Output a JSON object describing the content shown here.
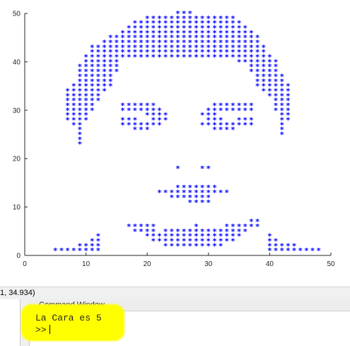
{
  "figure": {
    "coordinate_readout": "1, 34.934)",
    "marker_symbol": "*",
    "marker_color": "#0000ff",
    "axis_color": "#262626"
  },
  "chart_data": {
    "type": "scatter",
    "title": "",
    "xlabel": "",
    "ylabel": "",
    "xlim": [
      0,
      50
    ],
    "ylim": [
      0,
      50
    ],
    "xticks": [
      0,
      10,
      20,
      30,
      40,
      50
    ],
    "yticks": [
      0,
      10,
      20,
      30,
      40,
      50
    ],
    "grid": false,
    "series": [
      {
        "marker": "*",
        "color": "#0000ff",
        "hair": {
          "rows": [
            {
              "y": 50,
              "x0": 25,
              "x1": 27
            },
            {
              "y": 49,
              "x0": 20,
              "x1": 34
            },
            {
              "y": 48,
              "x0": 18,
              "x1": 35
            },
            {
              "y": 47,
              "x0": 17,
              "x1": 36
            },
            {
              "y": 46,
              "x0": 16,
              "x1": 37
            },
            {
              "y": 45,
              "x0": 14,
              "x1": 38
            },
            {
              "y": 44,
              "x0": 13,
              "x1": 38
            },
            {
              "y": 43,
              "x0": 11,
              "x1": 39
            },
            {
              "y": 42,
              "x0": 11,
              "x1": 39
            },
            {
              "y": 41,
              "x0": 10,
              "x1": 40
            }
          ],
          "left_side": [
            {
              "y": 40,
              "x0": 10,
              "x1": 15
            },
            {
              "y": 39,
              "x0": 9,
              "x1": 15
            },
            {
              "y": 38,
              "x0": 9,
              "x1": 15
            },
            {
              "y": 37,
              "x0": 9,
              "x1": 14
            },
            {
              "y": 36,
              "x0": 9,
              "x1": 14
            },
            {
              "y": 35,
              "x0": 8,
              "x1": 14
            },
            {
              "y": 34,
              "x0": 7,
              "x1": 13
            },
            {
              "y": 33,
              "x0": 7,
              "x1": 12
            },
            {
              "y": 32,
              "x0": 7,
              "x1": 12
            },
            {
              "y": 31,
              "x0": 7,
              "x1": 11
            },
            {
              "y": 30,
              "x0": 7,
              "x1": 11
            },
            {
              "y": 29,
              "x0": 7,
              "x1": 10
            },
            {
              "y": 28,
              "x0": 7,
              "x1": 10
            },
            {
              "y": 27,
              "x0": 8,
              "x1": 9
            },
            {
              "y": 26,
              "x0": 9,
              "x1": 9
            },
            {
              "y": 25,
              "x0": 9,
              "x1": 9
            },
            {
              "y": 24,
              "x0": 9,
              "x1": 9
            },
            {
              "y": 23,
              "x0": 9,
              "x1": 9
            }
          ],
          "right_side": [
            {
              "y": 40,
              "x0": 35,
              "x1": 41
            },
            {
              "y": 39,
              "x0": 37,
              "x1": 41
            },
            {
              "y": 38,
              "x0": 37,
              "x1": 41
            },
            {
              "y": 37,
              "x0": 38,
              "x1": 42
            },
            {
              "y": 36,
              "x0": 38,
              "x1": 42
            },
            {
              "y": 35,
              "x0": 38,
              "x1": 43
            },
            {
              "y": 34,
              "x0": 39,
              "x1": 43
            },
            {
              "y": 33,
              "x0": 40,
              "x1": 43
            },
            {
              "y": 32,
              "x0": 41,
              "x1": 43
            },
            {
              "y": 31,
              "x0": 41,
              "x1": 43
            },
            {
              "y": 30,
              "x0": 41,
              "x1": 43
            },
            {
              "y": 29,
              "x0": 42,
              "x1": 43
            },
            {
              "y": 28,
              "x0": 42,
              "x1": 43
            },
            {
              "y": 27,
              "x0": 42,
              "x1": 42
            },
            {
              "y": 26,
              "x0": 42,
              "x1": 42
            },
            {
              "y": 25,
              "x0": 42,
              "x1": 42
            }
          ]
        },
        "left_eye": [
          {
            "y": 31,
            "x0": 16,
            "x1": 21
          },
          {
            "y": 30,
            "x0": 16,
            "x1": 22
          },
          {
            "y": 29,
            "x0": 20,
            "x1": 23
          },
          {
            "y": 28,
            "x0": 16,
            "x1": 18
          },
          {
            "y": 28,
            "x0": 21,
            "x1": 23
          },
          {
            "y": 27,
            "x0": 16,
            "x1": 22
          },
          {
            "y": 26,
            "x0": 18,
            "x1": 20
          }
        ],
        "right_eye": [
          {
            "y": 31,
            "x0": 31,
            "x1": 37
          },
          {
            "y": 30,
            "x0": 30,
            "x1": 37
          },
          {
            "y": 29,
            "x0": 29,
            "x1": 31
          },
          {
            "y": 28,
            "x0": 30,
            "x1": 32
          },
          {
            "y": 28,
            "x0": 35,
            "x1": 37
          },
          {
            "y": 27,
            "x0": 29,
            "x1": 37
          },
          {
            "y": 26,
            "x0": 31,
            "x1": 34
          }
        ],
        "nose": [
          {
            "x": 25,
            "y": 18
          },
          {
            "x": 29,
            "y": 18
          },
          {
            "x": 30,
            "y": 18
          }
        ],
        "mustache": [
          {
            "y": 14,
            "x0": 25,
            "x1": 31
          },
          {
            "y": 13,
            "x0": 22,
            "x1": 33
          },
          {
            "y": 12,
            "x0": 24,
            "x1": 30
          },
          {
            "y": 11,
            "x0": 27,
            "x1": 30
          }
        ],
        "mouth": [
          {
            "y": 7,
            "x0": 37,
            "x1": 38
          },
          {
            "y": 6,
            "x0": 17,
            "x1": 21
          },
          {
            "y": 6,
            "x0": 28,
            "x1": 28
          },
          {
            "y": 6,
            "x0": 33,
            "x1": 38
          },
          {
            "y": 5,
            "x0": 18,
            "x1": 21
          },
          {
            "y": 5,
            "x0": 23,
            "x1": 36
          },
          {
            "y": 4,
            "x0": 20,
            "x1": 35
          },
          {
            "y": 3,
            "x0": 21,
            "x1": 34
          },
          {
            "y": 2,
            "x0": 23,
            "x1": 32
          }
        ],
        "chin_left": [
          {
            "y": 4,
            "x0": 12,
            "x1": 12
          },
          {
            "y": 3,
            "x0": 11,
            "x1": 12
          },
          {
            "y": 2,
            "x0": 9,
            "x1": 12
          },
          {
            "y": 1,
            "x0": 5,
            "x1": 12
          }
        ],
        "chin_right": [
          {
            "y": 4,
            "x0": 40,
            "x1": 40
          },
          {
            "y": 3,
            "x0": 40,
            "x1": 41
          },
          {
            "y": 2,
            "x0": 40,
            "x1": 44
          },
          {
            "y": 1,
            "x0": 40,
            "x1": 48
          }
        ]
      }
    ]
  },
  "command_window": {
    "title": "Command Window",
    "output_line": "La Cara es 5",
    "prompt": ">>"
  }
}
